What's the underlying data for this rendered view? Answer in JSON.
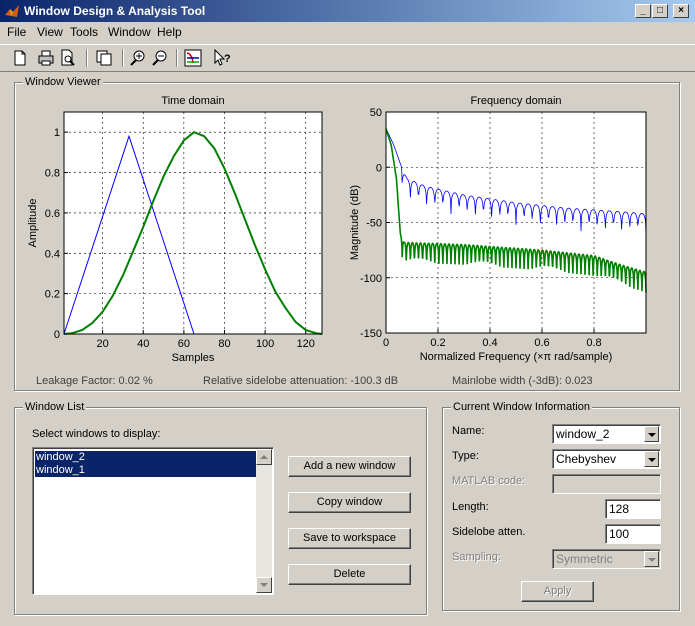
{
  "window": {
    "title": "Window Design & Analysis Tool",
    "buttons": [
      "_",
      "□",
      "×"
    ]
  },
  "menu": [
    "File",
    "View",
    "Tools",
    "Window",
    "Help"
  ],
  "toolbar": [
    "new-icon",
    "print-icon",
    "print-preview-icon",
    "new-figure-icon",
    "zoom-in-icon",
    "zoom-out-icon",
    "fvtool-icon",
    "whats-this-icon"
  ],
  "viewer": {
    "title": "Window Viewer",
    "leakage": "Leakage Factor: 0.02 %",
    "sidelobe": "Relative sidelobe attenuation: -100.3 dB",
    "mainlobe": "Mainlobe width (-3dB): 0.023"
  },
  "chart_data": [
    {
      "type": "line",
      "title": "Time domain",
      "xlabel": "Samples",
      "ylabel": "Amplitude",
      "xlim": [
        1,
        128
      ],
      "ylim": [
        0,
        1.1
      ],
      "xticks": [
        20,
        40,
        60,
        80,
        100,
        120
      ],
      "yticks": [
        0,
        0.2,
        0.4,
        0.6,
        0.8,
        1
      ],
      "grid": true,
      "series": [
        {
          "color": "#0000ff",
          "x": [
            1,
            33,
            65
          ],
          "y": [
            0,
            0.98,
            0
          ]
        },
        {
          "color": "#008000",
          "x": [
            1,
            5,
            10,
            15,
            20,
            25,
            30,
            35,
            40,
            45,
            50,
            55,
            60,
            65,
            70,
            75,
            80,
            85,
            90,
            95,
            100,
            105,
            110,
            115,
            120,
            125,
            128
          ],
          "y": [
            0,
            0.004,
            0.02,
            0.055,
            0.11,
            0.19,
            0.29,
            0.41,
            0.53,
            0.66,
            0.78,
            0.88,
            0.96,
            1.0,
            0.98,
            0.92,
            0.82,
            0.7,
            0.57,
            0.44,
            0.32,
            0.21,
            0.13,
            0.06,
            0.02,
            0.004,
            0
          ]
        }
      ]
    },
    {
      "type": "line",
      "title": "Frequency domain",
      "xlabel": "Normalized Frequency  (×π rad/sample)",
      "ylabel": "Magnitude (dB)",
      "xlim": [
        0,
        1
      ],
      "ylim": [
        -150,
        50
      ],
      "xticks": [
        0,
        0.2,
        0.4,
        0.6,
        0.8
      ],
      "yticks": [
        -150,
        -100,
        -50,
        0,
        50
      ],
      "grid": true,
      "series": [
        {
          "color": "#0000ff",
          "envelope": [
            [
              0,
              35
            ],
            [
              0.03,
              20
            ],
            [
              0.06,
              0
            ],
            [
              0.08,
              -10
            ],
            [
              0.15,
              -17
            ],
            [
              0.3,
              -25
            ],
            [
              0.5,
              -32
            ],
            [
              0.7,
              -37
            ],
            [
              0.9,
              -40
            ],
            [
              1.0,
              -42
            ]
          ]
        },
        {
          "color": "#008000",
          "envelope": [
            [
              0,
              35
            ],
            [
              0.02,
              20
            ],
            [
              0.04,
              -10
            ],
            [
              0.055,
              -60
            ],
            [
              0.07,
              -68
            ],
            [
              0.3,
              -70
            ],
            [
              0.6,
              -75
            ],
            [
              0.8,
              -80
            ],
            [
              0.9,
              -88
            ],
            [
              1.0,
              -95
            ]
          ]
        }
      ]
    }
  ],
  "window_list": {
    "title": "Window List",
    "prompt": "Select windows to display:",
    "items": [
      "window_2",
      "window_1"
    ],
    "buttons": {
      "add": "Add a new window",
      "copy": "Copy window",
      "save": "Save to workspace",
      "delete": "Delete"
    }
  },
  "info": {
    "title": "Current Window Information",
    "name_label": "Name:",
    "name_value": "window_2",
    "type_label": "Type:",
    "type_value": "Chebyshev",
    "matlab_label": "MATLAB code:",
    "matlab_value": "",
    "length_label": "Length:",
    "length_value": "128",
    "sidelobe_label": "Sidelobe atten.",
    "sidelobe_value": "100",
    "sampling_label": "Sampling:",
    "sampling_value": "Symmetric",
    "apply": "Apply"
  }
}
